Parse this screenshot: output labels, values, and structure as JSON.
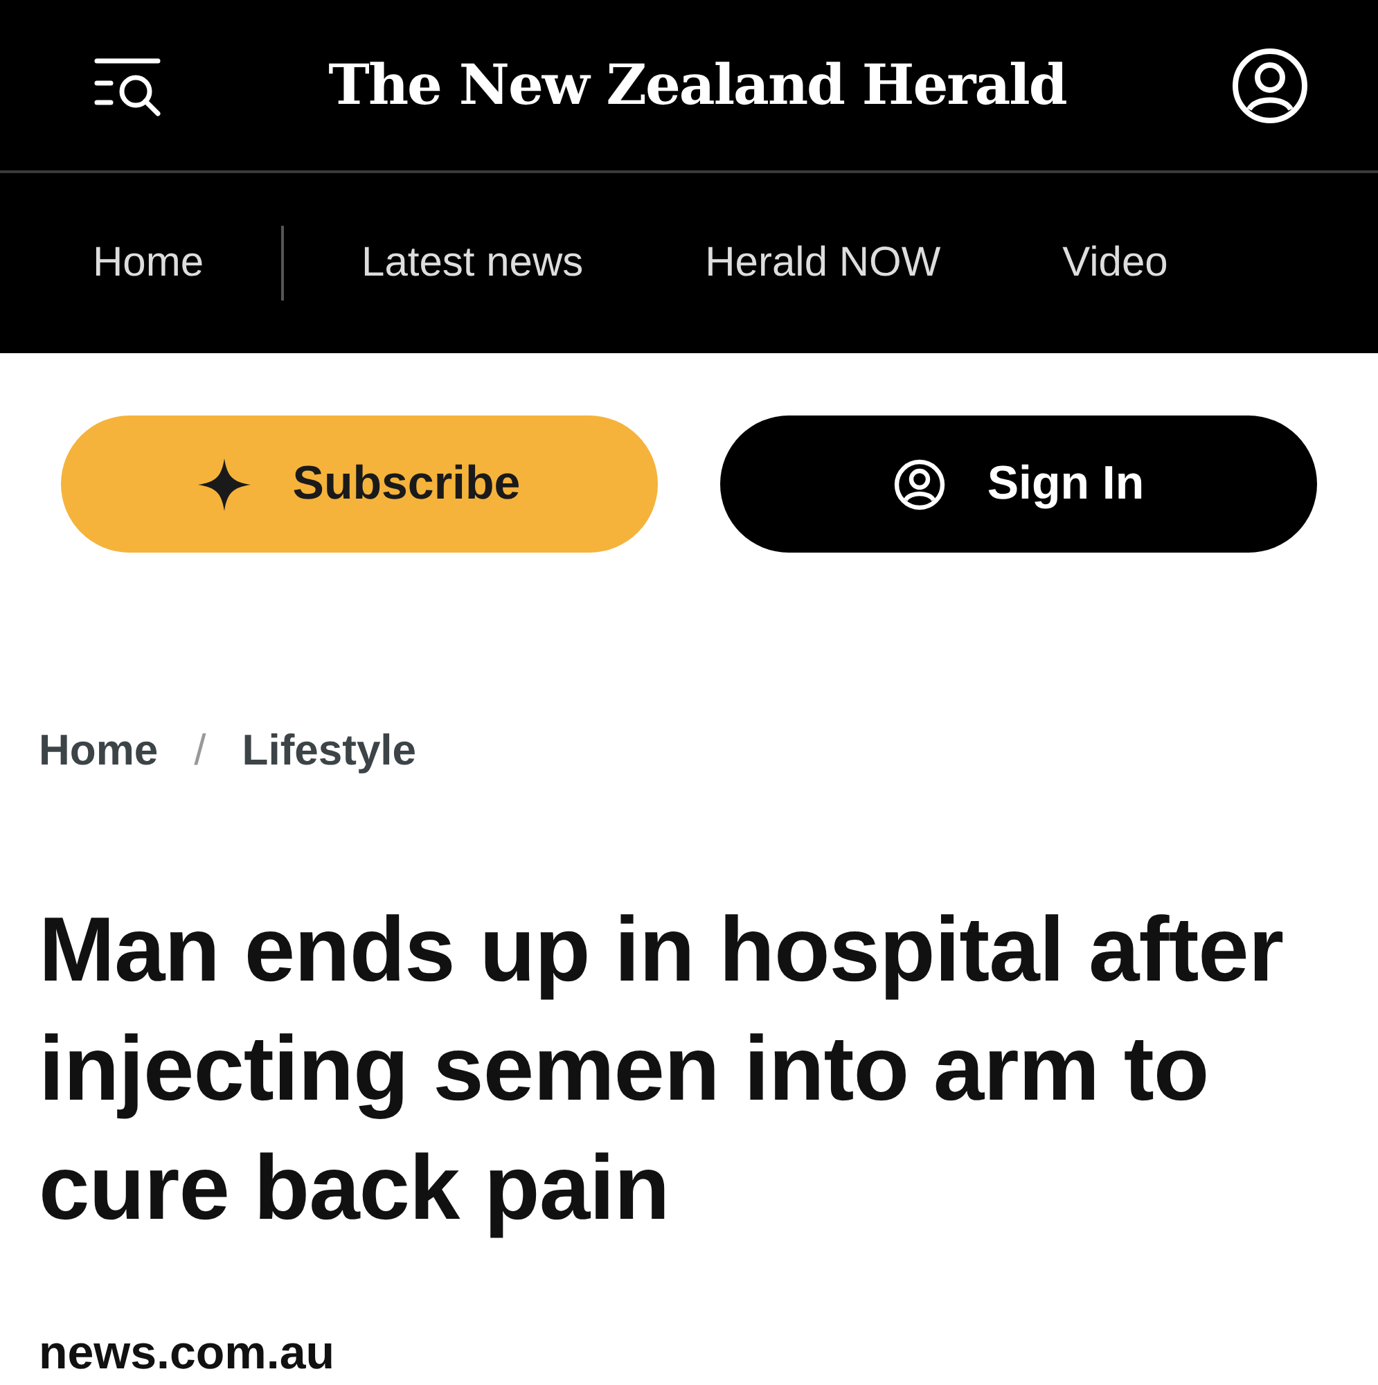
{
  "header": {
    "logo": "The New Zealand Herald"
  },
  "nav": {
    "items": [
      {
        "label": "Home"
      },
      {
        "label": "Latest news"
      },
      {
        "label": "Herald NOW"
      },
      {
        "label": "Video"
      }
    ]
  },
  "actions": {
    "subscribe": "Subscribe",
    "sign_in": "Sign In"
  },
  "breadcrumb": [
    {
      "label": "Home"
    },
    {
      "label": "Lifestyle"
    }
  ],
  "breadcrumb_separator": "/",
  "article": {
    "headline": "Man ends up in hospital after injecting semen into arm to cure back pain",
    "source": "news.com.au"
  }
}
